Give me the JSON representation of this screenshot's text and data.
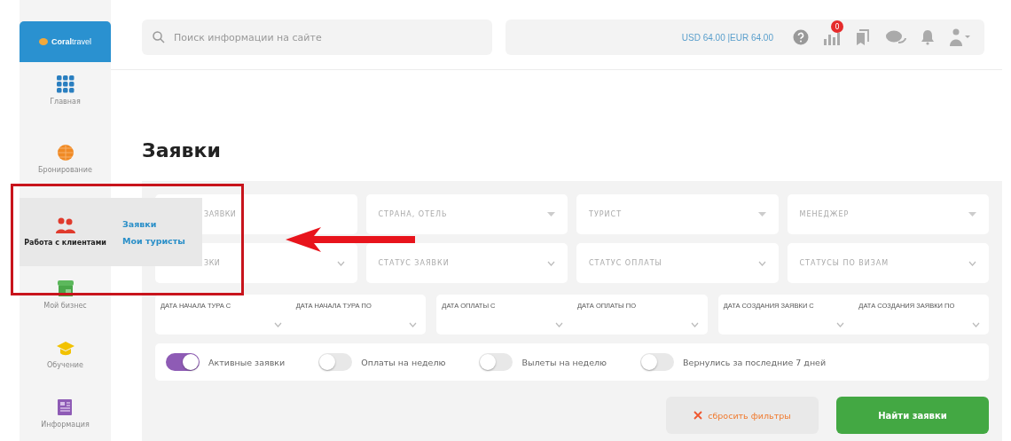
{
  "sidebar": {
    "logo": "**Coral**travel",
    "items": [
      {
        "label": "Главная",
        "selected": false
      },
      {
        "label": "Бронирование",
        "selected": false
      },
      {
        "label": "Работа с клиентами",
        "selected": true,
        "submenu": [
          "Заявки",
          "Мои туристы"
        ]
      },
      {
        "label": "Мой бизнес",
        "selected": false
      },
      {
        "label": "Обучение",
        "selected": false
      },
      {
        "label": "Информация",
        "selected": false
      }
    ]
  },
  "header": {
    "search": {
      "placeholder": "Поиск информации на сайте"
    },
    "rates": "USD 64.00 |EUR 64.00",
    "stats_badge": "0"
  },
  "page_title": "Заявки",
  "filters": {
    "rows": [
      [
        "ЗАЯВКИ",
        "СТРАНА, ОТЕЛЬ",
        "ТУРИСТ",
        "МЕНЕДЖЕР"
      ],
      [
        "ЗКИ",
        "СТАТУС ЗАЯВКИ",
        "СТАТУС ОПЛАТЫ",
        "СТАТУСЫ ПО ВИЗАМ"
      ]
    ],
    "date_ranges": [
      [
        "ДАТА НАЧАЛА ТУРА С",
        "ДАТА НАЧАЛА ТУРА ПО"
      ],
      [
        "ДАТА ОПЛАТЫ С",
        "ДАТА ОПЛАТЫ ПО"
      ],
      [
        "ДАТА СОЗДАНИЯ ЗАЯВКИ С",
        "ДАТА СОЗДАНИЯ ЗАЯВКИ ПО"
      ]
    ],
    "toggles": [
      {
        "label": "Активные заявки",
        "on": true
      },
      {
        "label": "Оплаты на неделю",
        "on": false
      },
      {
        "label": "Вылеты на неделю",
        "on": false
      },
      {
        "label": "Вернулись за последние 7 дней",
        "on": false
      }
    ],
    "reset_button": "сбросить фильтры",
    "search_button": "Найти заявки"
  }
}
